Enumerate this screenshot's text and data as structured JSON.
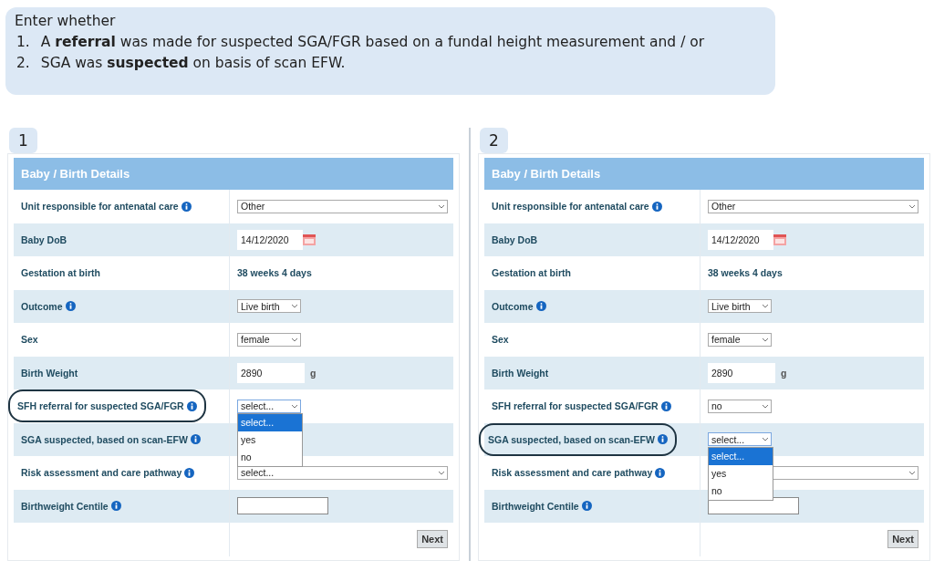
{
  "note": {
    "intro": "Enter whether",
    "items": [
      {
        "number": "1.",
        "text": "A **referral** was made for suspected SGA/FGR based on a fundal height measurement and / or"
      },
      {
        "number": "2.",
        "text": "SGA was **suspected** on basis of scan EFW."
      }
    ]
  },
  "panels": [
    {
      "number": "1",
      "title": "Baby / Birth Details",
      "rows": [
        {
          "label": "Unit responsible for antenatal care",
          "info": true,
          "kind": "select",
          "wide": true,
          "value": "Other",
          "circled": false
        },
        {
          "label": "Baby DoB",
          "info": false,
          "kind": "date",
          "value": "14/12/2020",
          "circled": false
        },
        {
          "label": "Gestation at birth",
          "info": false,
          "kind": "static",
          "value": "38 weeks 4 days",
          "circled": false
        },
        {
          "label": "Outcome",
          "info": true,
          "kind": "select",
          "wide": false,
          "value": "Live birth",
          "circled": false
        },
        {
          "label": "Sex",
          "info": false,
          "kind": "select",
          "wide": false,
          "value": "female",
          "circled": false
        },
        {
          "label": "Birth Weight",
          "info": false,
          "kind": "input",
          "value": "2890",
          "unit": "g",
          "circled": false
        },
        {
          "label": "SFH referral for suspected SGA/FGR",
          "info": true,
          "kind": "select",
          "wide": false,
          "value": "select...",
          "circled": true,
          "options": [
            {
              "label": "select...",
              "selected": true
            },
            {
              "label": "yes",
              "selected": false
            },
            {
              "label": "no",
              "selected": false
            }
          ]
        },
        {
          "label": "SGA suspected, based on scan-EFW",
          "info": true,
          "kind": "none",
          "circled": false
        },
        {
          "label": "Risk assessment and care pathway",
          "info": true,
          "kind": "select",
          "wide": true,
          "value": "select...",
          "circled": false
        },
        {
          "label": "Birthweight Centile",
          "info": true,
          "kind": "input",
          "circled": false
        }
      ],
      "button": "Next"
    },
    {
      "number": "2",
      "title": "Baby / Birth Details",
      "rows": [
        {
          "label": "Unit responsible for antenatal care",
          "info": true,
          "kind": "select",
          "wide": true,
          "value": "Other",
          "circled": false
        },
        {
          "label": "Baby DoB",
          "info": false,
          "kind": "date",
          "value": "14/12/2020",
          "circled": false
        },
        {
          "label": "Gestation at birth",
          "info": false,
          "kind": "static",
          "value": "38 weeks 4 days",
          "circled": false
        },
        {
          "label": "Outcome",
          "info": true,
          "kind": "select",
          "wide": false,
          "value": "Live birth",
          "circled": false
        },
        {
          "label": "Sex",
          "info": false,
          "kind": "select",
          "wide": false,
          "value": "female",
          "circled": false
        },
        {
          "label": "Birth Weight",
          "info": false,
          "kind": "input",
          "value": "2890",
          "unit": "g",
          "circled": false
        },
        {
          "label": "SFH referral for suspected SGA/FGR",
          "info": true,
          "kind": "select",
          "wide": false,
          "value": "no",
          "circled": false
        },
        {
          "label": "SGA suspected, based on scan-EFW",
          "info": true,
          "kind": "select",
          "wide": false,
          "value": "select...",
          "circled": true,
          "options": [
            {
              "label": "select...",
              "selected": true
            },
            {
              "label": "yes",
              "selected": false
            },
            {
              "label": "no",
              "selected": false
            }
          ]
        },
        {
          "label": "Risk assessment and care pathway",
          "info": true,
          "kind": "select",
          "wide": true,
          "circled": false
        },
        {
          "label": "Birthweight Centile",
          "info": true,
          "kind": "input",
          "circled": false
        }
      ],
      "button": "Next"
    }
  ]
}
